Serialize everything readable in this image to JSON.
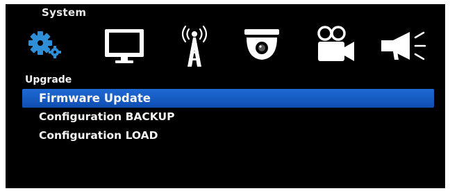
{
  "header": {
    "title": "System"
  },
  "icons": [
    {
      "name": "system-gear-icon",
      "active": true
    },
    {
      "name": "display-monitor-icon",
      "active": false
    },
    {
      "name": "network-antenna-icon",
      "active": false
    },
    {
      "name": "dome-camera-icon",
      "active": false
    },
    {
      "name": "video-camera-icon",
      "active": false
    },
    {
      "name": "alarm-megaphone-icon",
      "active": false
    }
  ],
  "section": {
    "label": "Upgrade"
  },
  "menu": {
    "items": [
      {
        "label": "Firmware Update",
        "selected": true
      },
      {
        "label": "Configuration BACKUP",
        "selected": false
      },
      {
        "label": "Configuration LOAD",
        "selected": false
      }
    ]
  },
  "colors": {
    "background": "#000000",
    "highlight": "#1a5fc8",
    "active_icon": "#2f8ed8",
    "icon": "#ffffff"
  }
}
